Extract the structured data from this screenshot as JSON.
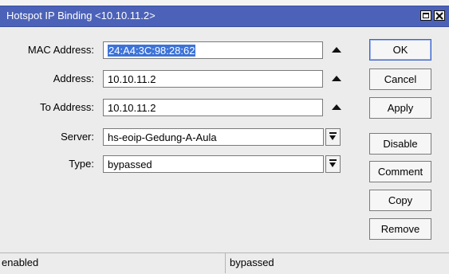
{
  "window": {
    "title": "Hotspot IP Binding <10.10.11.2>"
  },
  "form": {
    "mac_address": {
      "label": "MAC Address:",
      "value": "24:A4:3C:98:28:62"
    },
    "address": {
      "label": "Address:",
      "value": "10.10.11.2"
    },
    "to_address": {
      "label": "To Address:",
      "value": "10.10.11.2"
    },
    "server": {
      "label": "Server:",
      "value": "hs-eoip-Gedung-A-Aula"
    },
    "type": {
      "label": "Type:",
      "value": "bypassed"
    }
  },
  "buttons": {
    "ok": "OK",
    "cancel": "Cancel",
    "apply": "Apply",
    "disable": "Disable",
    "comment": "Comment",
    "copy": "Copy",
    "remove": "Remove"
  },
  "status": {
    "left": "enabled",
    "right": "bypassed"
  },
  "colors": {
    "title_bar": "#4c62b8",
    "selection": "#3d73d8"
  }
}
